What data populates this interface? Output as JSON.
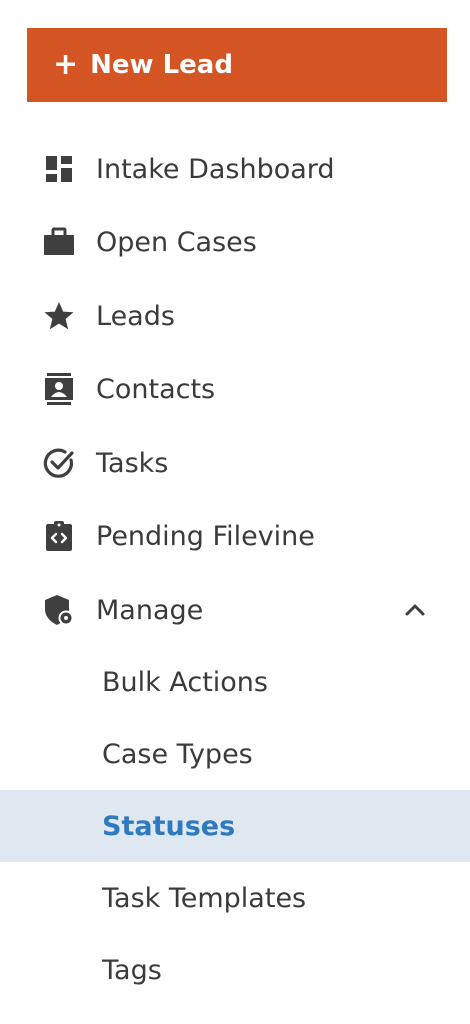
{
  "new_lead": {
    "plus": "+",
    "label": "New Lead",
    "color": "#d45523"
  },
  "nav": {
    "items": [
      {
        "label": "Intake Dashboard",
        "icon": "dashboard-icon"
      },
      {
        "label": "Open Cases",
        "icon": "briefcase-icon"
      },
      {
        "label": "Leads",
        "icon": "star-icon"
      },
      {
        "label": "Contacts",
        "icon": "contact-card-icon"
      },
      {
        "label": "Tasks",
        "icon": "check-circle-icon"
      },
      {
        "label": "Pending Filevine",
        "icon": "code-clipboard-icon"
      },
      {
        "label": "Manage",
        "icon": "shield-gear-icon",
        "expanded": true
      }
    ],
    "manage_sub": [
      {
        "label": "Bulk Actions"
      },
      {
        "label": "Case Types"
      },
      {
        "label": "Statuses",
        "active": true
      },
      {
        "label": "Task Templates"
      },
      {
        "label": "Tags"
      }
    ]
  },
  "colors": {
    "text": "#3b3b3b",
    "icon": "#3f3f3f",
    "active_bg": "#dfe7f1",
    "active_text": "#2f79bf"
  }
}
